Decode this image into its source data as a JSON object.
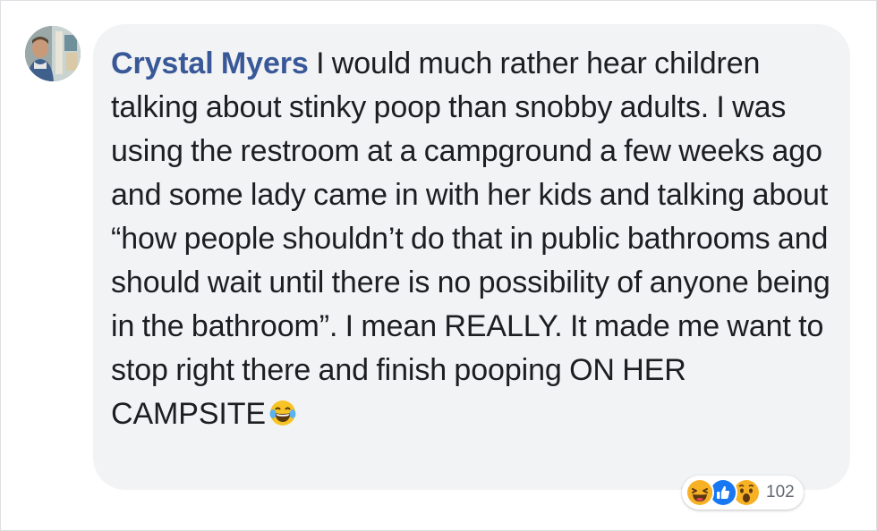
{
  "comment": {
    "author": "Crystal Myers",
    "text": "I would much rather hear children talking about stinky poop than snobby adults. I was using the restroom at a campground a few weeks ago and some lady came in with her kids and talking about “how people shouldn’t do that in public bathrooms and should wait until there is no possibility of anyone being in the bathroom”. I mean REALLY. It made me want to stop right there and finish pooping ON HER CAMPSITE",
    "inline_emoji": "laughing-tears-emoji"
  },
  "reactions": {
    "icons": [
      "haha-reaction-icon",
      "like-reaction-icon",
      "wow-reaction-icon"
    ],
    "count": "102"
  },
  "colors": {
    "author_link": "#385898",
    "bubble_bg": "#f2f3f5",
    "text": "#1c1e21",
    "like_blue": "#1877f2",
    "reaction_yellow": "#f7b125"
  }
}
